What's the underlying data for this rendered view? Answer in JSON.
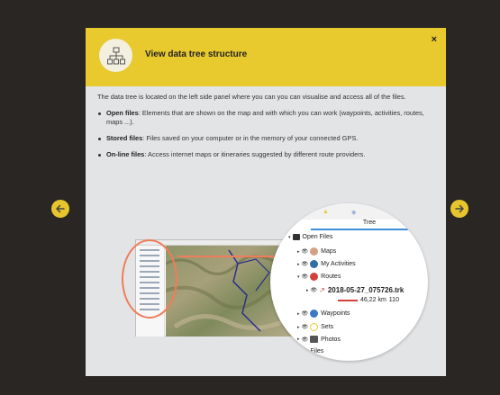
{
  "modal": {
    "title": "View data tree structure",
    "close_label": "×",
    "intro": "The data tree is located on the left side panel where you can you can visualise and access all of the files.",
    "bullets": [
      {
        "term": "Open files",
        "text": ": Elements that are shown on the map and with which you can work (waypoints, activities, routes, maps ...)."
      },
      {
        "term": "Stored files",
        "text": ": Files saved on your computer or in the memory of your connected GPS."
      },
      {
        "term": "On-line files",
        "text": ": Access internet maps or itineraries suggested by different route providers."
      }
    ]
  },
  "tree": {
    "tab_label": "Tree",
    "open_files": "Open Files",
    "maps": "Maps",
    "activities": "My Activities",
    "routes": "Routes",
    "track": "2018-05-27_075726.trk",
    "distance": "46,22 km",
    "extra": "110",
    "waypoints": "Waypoints",
    "sets": "Sets",
    "photos": "Photos",
    "files": "Files"
  },
  "colors": {
    "accent": "#e8c92e",
    "background": "#2a2624",
    "panel": "#e3e4e6",
    "highlight": "#ef7d5a"
  },
  "icons": {
    "header": "tree-structure-icon",
    "prev": "arrow-left-icon",
    "next": "arrow-right-icon"
  }
}
